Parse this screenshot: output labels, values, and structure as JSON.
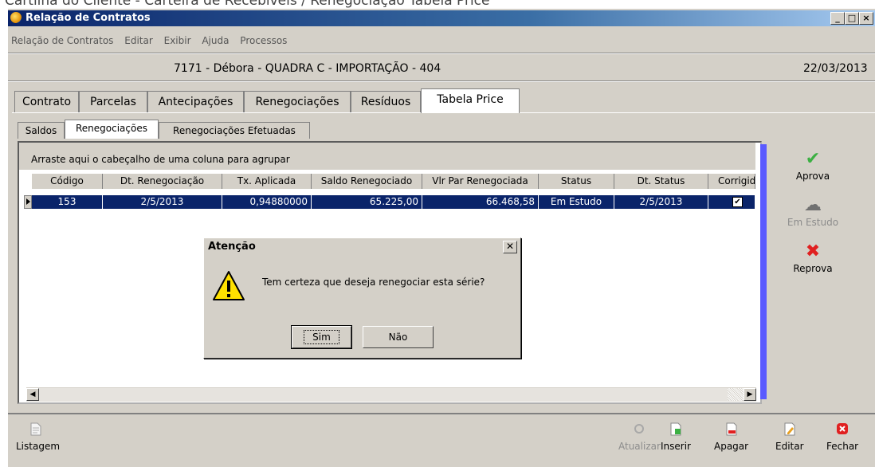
{
  "doc_title": "Cartilha do Cliente - Carteira de Recebíveis / Renegociação Tabela Price",
  "window": {
    "title": "Relação de Contratos",
    "minimize": "_",
    "maximize": "□",
    "close": "×"
  },
  "menu": [
    "Relação de Contratos",
    "Editar",
    "Exibir",
    "Ajuda",
    "Processos"
  ],
  "header": {
    "contract": "7171 - Débora - QUADRA C - IMPORTAÇÃO - 404",
    "date": "22/03/2013"
  },
  "tabs": [
    "Contrato",
    "Parcelas",
    "Antecipações",
    "Renegociações",
    "Resíduos",
    "Tabela Price"
  ],
  "active_tab": "Tabela Price",
  "subtabs": [
    "Saldos",
    "Renegociações",
    "Renegociações Efetuadas"
  ],
  "active_subtab": "Renegociações",
  "grid": {
    "group_hint": "Arraste aqui o cabeçalho de uma coluna para agrupar",
    "columns": [
      "Código",
      "Dt. Renegociação",
      "Tx. Aplicada",
      "Saldo Renegociado",
      "Vlr Par Renegociada",
      "Status",
      "Dt. Status",
      "Corrigid"
    ],
    "rows": [
      {
        "codigo": "153",
        "dt_reneg": "2/5/2013",
        "tx": "0,94880000",
        "saldo": "65.225,00",
        "vlr_par": "66.468,58",
        "status": "Em Estudo",
        "dt_status": "2/5/2013",
        "corrigido": "✔"
      }
    ]
  },
  "side_actions": [
    {
      "label": "Aprova",
      "icon": "check-icon",
      "enabled": true
    },
    {
      "label": "Em Estudo",
      "icon": "study-icon",
      "enabled": false
    },
    {
      "label": "Reprova",
      "icon": "x-icon",
      "enabled": true
    }
  ],
  "bottom_actions": {
    "listagem": "Listagem",
    "atualizar": "Atualizar",
    "inserir": "Inserir",
    "apagar": "Apagar",
    "editar": "Editar",
    "fechar": "Fechar"
  },
  "dialog": {
    "title": "Atenção",
    "message": "Tem certeza que deseja renegociar esta série?",
    "yes": "Sim",
    "no": "Não",
    "icon": "warning-icon"
  },
  "colors": {
    "title_bar": "#0a246a",
    "selection": "#0a246a",
    "accent_bar": "#5a5aff",
    "face": "#d4d0c8"
  }
}
